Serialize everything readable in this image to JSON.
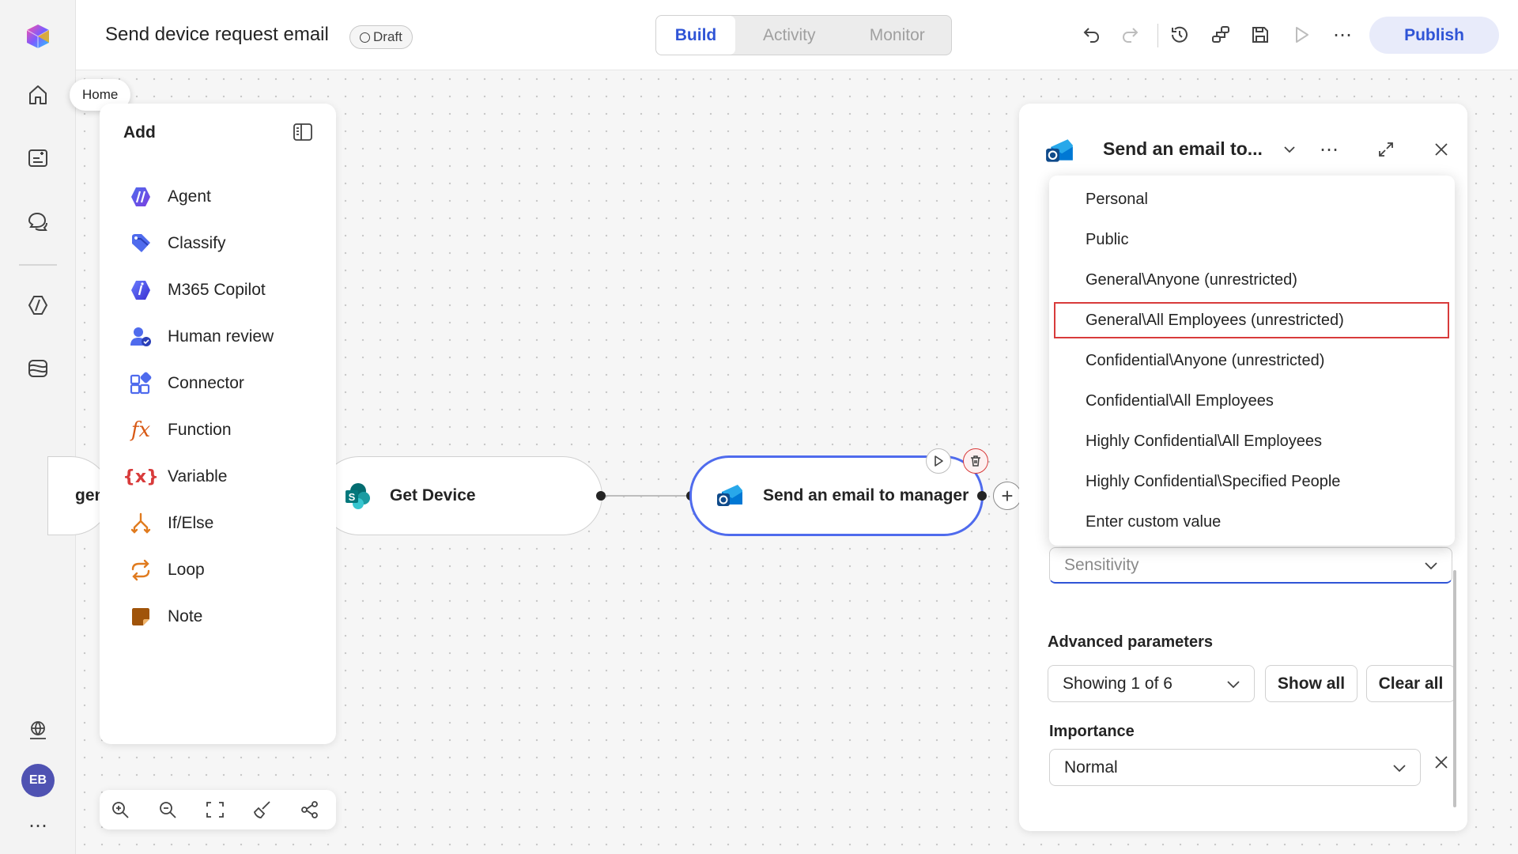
{
  "app": {
    "title": "Send device request email",
    "status_badge": "Draft",
    "modes": [
      "Build",
      "Activity",
      "Monitor"
    ],
    "active_mode": "Build",
    "publish_label": "Publish"
  },
  "rail": {
    "tooltip": "Home",
    "avatar_initials": "EB"
  },
  "add_panel": {
    "title": "Add",
    "items": [
      {
        "label": "Agent",
        "icon": "agent-icon"
      },
      {
        "label": "Classify",
        "icon": "classify-icon"
      },
      {
        "label": "M365 Copilot",
        "icon": "copilot-icon"
      },
      {
        "label": "Human review",
        "icon": "human-review-icon"
      },
      {
        "label": "Connector",
        "icon": "connector-icon"
      },
      {
        "label": "Function",
        "icon": "function-icon"
      },
      {
        "label": "Variable",
        "icon": "variable-icon"
      },
      {
        "label": "If/Else",
        "icon": "if-else-icon"
      },
      {
        "label": "Loop",
        "icon": "loop-icon"
      },
      {
        "label": "Note",
        "icon": "note-icon"
      }
    ]
  },
  "canvas": {
    "nodes": [
      {
        "label": "gen"
      },
      {
        "label": "Get Device"
      },
      {
        "label": "Send an email to manager"
      }
    ]
  },
  "right_panel": {
    "title": "Send an email to...",
    "sensitivity_placeholder": "Sensitivity",
    "advanced_label": "Advanced parameters",
    "advanced_select": "Showing 1 of 6",
    "show_all": "Show all",
    "clear_all": "Clear all",
    "importance_label": "Importance",
    "importance_value": "Normal"
  },
  "dropdown": {
    "options": [
      "Personal",
      "Public",
      "General\\Anyone (unrestricted)",
      "General\\All Employees (unrestricted)",
      "Confidential\\Anyone (unrestricted)",
      "Confidential\\All Employees",
      "Highly Confidential\\All Employees",
      "Highly Confidential\\Specified People",
      "Enter custom value"
    ],
    "highlighted": "General\\All Employees (unrestricted)"
  },
  "colors": {
    "accent": "#2f54d6",
    "selected_node_border": "#4f6bed",
    "highlight_border": "#d83b3b"
  }
}
